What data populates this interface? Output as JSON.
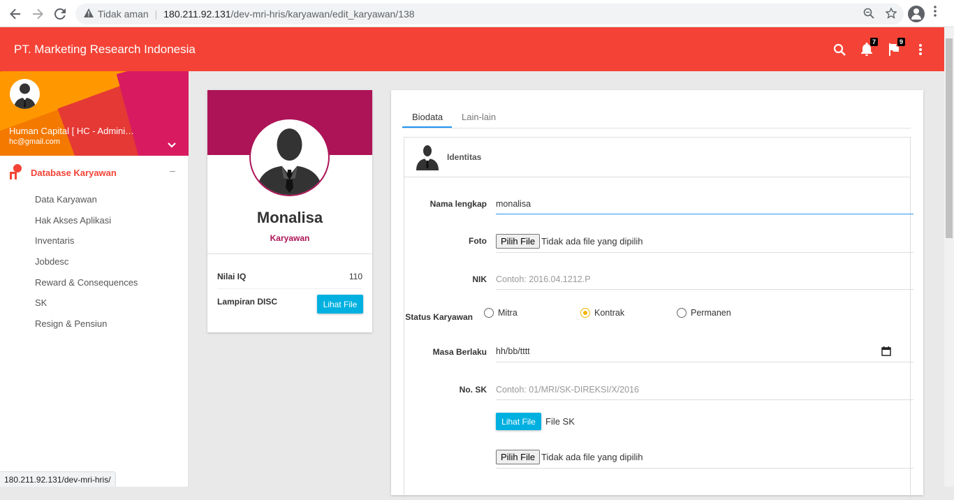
{
  "browser": {
    "security_label": "Tidak aman",
    "url_host": "180.211.92.131",
    "url_path": "/dev-mri-hris/karyawan/edit_karyawan/138",
    "status_url": "180.211.92.131/dev-mri-hris/"
  },
  "header": {
    "title": "PT. Marketing Research Indonesia",
    "notifications_count": "7",
    "flags_count": "9",
    "accent_color": "#f44336"
  },
  "sidebar": {
    "user_name": "Human Capital [ HC - Administ...",
    "user_email": "hc@gmail.com",
    "section_label": "Database Karyawan",
    "items": [
      {
        "label": "Data Karyawan"
      },
      {
        "label": "Hak Akses Aplikasi"
      },
      {
        "label": "Inventaris"
      },
      {
        "label": "Jobdesc"
      },
      {
        "label": "Reward & Consequences"
      },
      {
        "label": "SK"
      },
      {
        "label": "Resign & Pensiun"
      }
    ]
  },
  "profile": {
    "name": "Monalisa",
    "role": "Karyawan",
    "iq_label": "Nilai IQ",
    "iq_value": "110",
    "disc_label": "Lampiran DISC",
    "disc_button": "Lihat File",
    "banner_color": "#ad1457"
  },
  "form": {
    "tabs": [
      {
        "label": "Biodata",
        "active": true
      },
      {
        "label": "Lain-lain",
        "active": false
      }
    ],
    "section_title": "Identitas",
    "nama_label": "Nama lengkap",
    "nama_value": "monalisa",
    "foto_label": "Foto",
    "file_button": "Pilih File",
    "no_file_text": "Tidak ada file yang dipilih",
    "nik_label": "NIK",
    "nik_placeholder": "Contoh: 2016.04.1212.P",
    "status_label": "Status Karyawan",
    "status_options": [
      {
        "label": "Mitra",
        "checked": false
      },
      {
        "label": "Kontrak",
        "checked": true
      },
      {
        "label": "Permanen",
        "checked": false
      }
    ],
    "masa_label": "Masa Berlaku",
    "masa_placeholder": "hh/bb/tttt",
    "sk_label": "No. SK",
    "sk_placeholder": "Contoh: 01/MRI/SK-DIREKSI/X/2016",
    "sk_view_button": "Lihat File",
    "sk_file_label": "File SK",
    "sk_file_button": "Pilih File",
    "sk_no_file_text": "Tidak ada file yang dipilih"
  }
}
